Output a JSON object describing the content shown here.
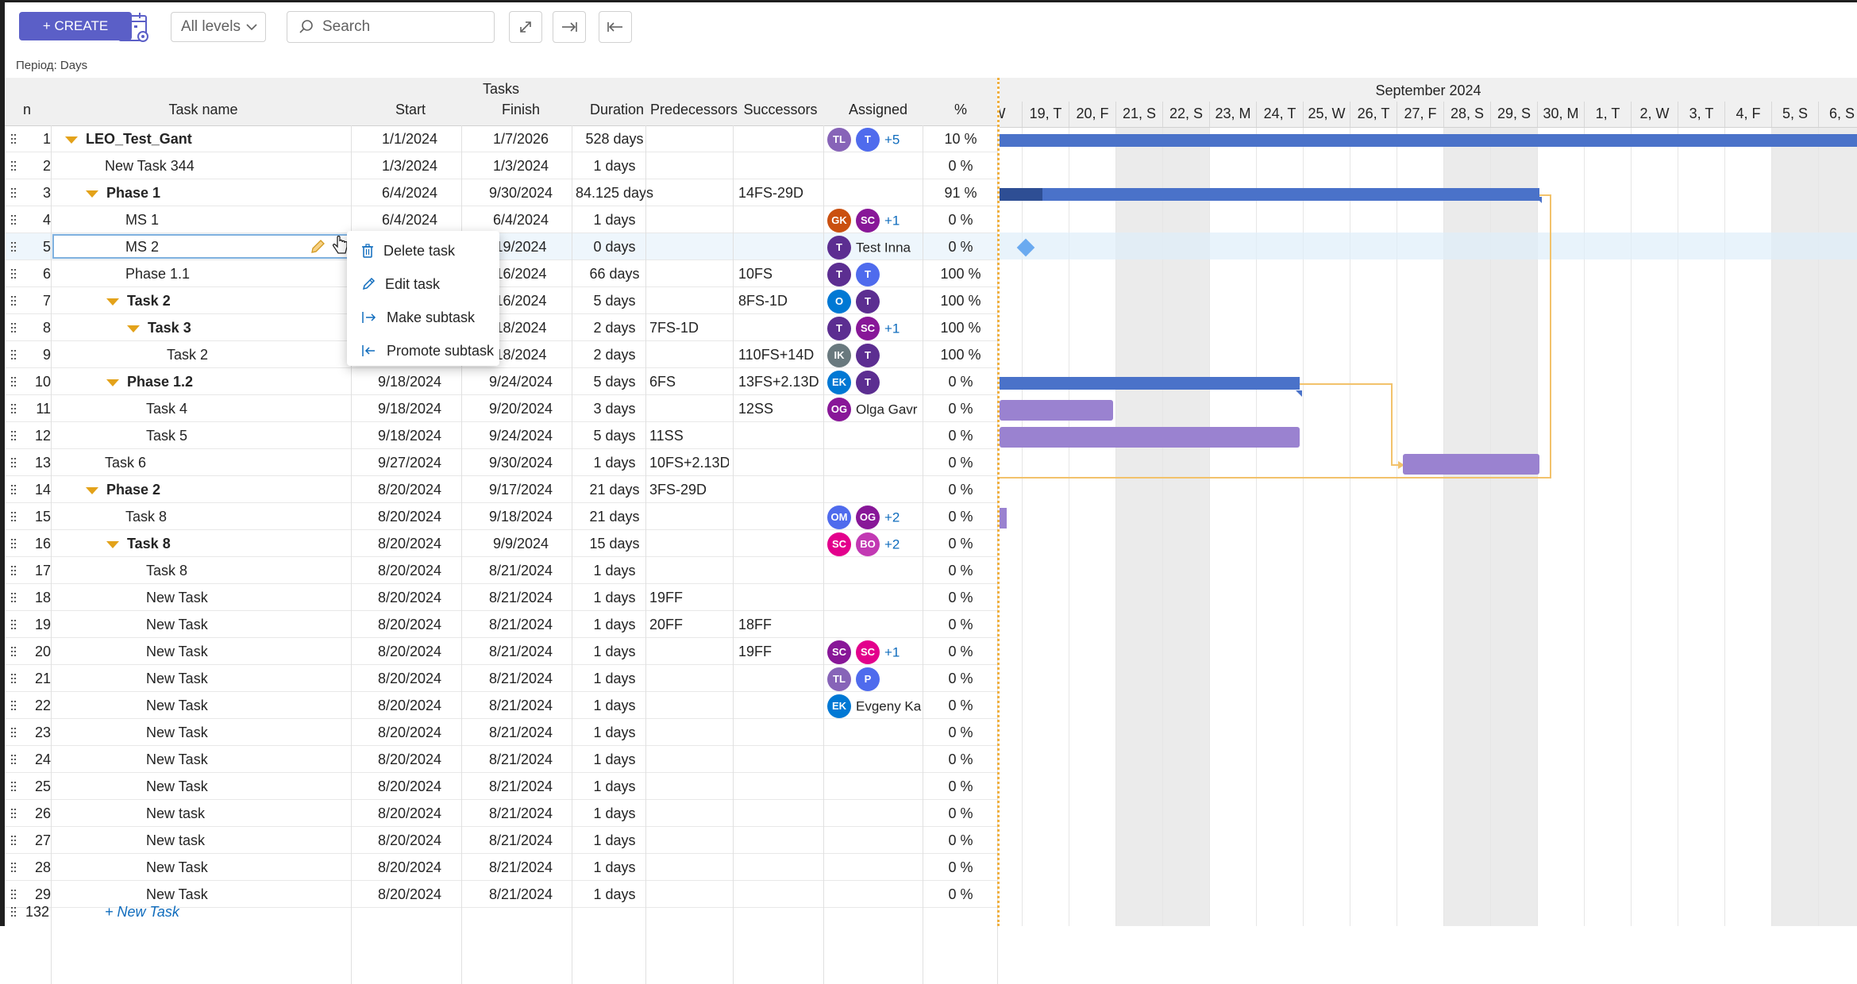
{
  "toolbar": {
    "create_label": "+ CREATE",
    "levels_label": "All levels",
    "search_placeholder": "Search",
    "period_label": "Період: Days"
  },
  "grid": {
    "group_header": "Tasks",
    "columns": [
      "n",
      "Task name",
      "Start",
      "Finish",
      "Duration",
      "Predecessors",
      "Successors",
      "Assigned",
      "%"
    ],
    "rows": [
      {
        "n": "1",
        "name": "LEO_Test_Gant",
        "start": "1/1/2024",
        "finish": "1/7/2026",
        "duration": "528 days",
        "pred": "",
        "succ": "",
        "avatars": [
          {
            "t": "TL",
            "c": "#8764b8"
          },
          {
            "t": "T",
            "c": "#4f6bed"
          }
        ],
        "more": "+5",
        "aname": "",
        "pct": "10 %"
      },
      {
        "n": "2",
        "name": "New Task 344",
        "start": "1/3/2024",
        "finish": "1/3/2024",
        "duration": "1 days",
        "pred": "",
        "succ": "",
        "avatars": [],
        "more": "",
        "aname": "",
        "pct": "0 %"
      },
      {
        "n": "3",
        "name": "Phase 1",
        "start": "6/4/2024",
        "finish": "9/30/2024",
        "duration": "84.125 days",
        "pred": "",
        "succ": "14FS-29D",
        "avatars": [],
        "more": "",
        "aname": "",
        "pct": "91 %"
      },
      {
        "n": "4",
        "name": "MS 1",
        "start": "6/4/2024",
        "finish": "6/4/2024",
        "duration": "1 days",
        "pred": "",
        "succ": "",
        "avatars": [
          {
            "t": "GK",
            "c": "#ca5010"
          },
          {
            "t": "SC",
            "c": "#881798"
          }
        ],
        "more": "+1",
        "aname": "",
        "pct": "0 %"
      },
      {
        "n": "5",
        "name": "MS 2",
        "start": "",
        "finish": "19/2024",
        "duration": "0 days",
        "pred": "",
        "succ": "",
        "avatars": [
          {
            "t": "T",
            "c": "#5c2e91"
          }
        ],
        "more": "",
        "aname": "Test Inna",
        "pct": "0 %"
      },
      {
        "n": "6",
        "name": "Phase 1.1",
        "start": "",
        "finish": "16/2024",
        "duration": "66 days",
        "pred": "",
        "succ": "10FS",
        "avatars": [
          {
            "t": "T",
            "c": "#5c2e91"
          },
          {
            "t": "T",
            "c": "#4f6bed"
          }
        ],
        "more": "",
        "aname": "",
        "pct": "100 %"
      },
      {
        "n": "7",
        "name": "Task 2",
        "start": "",
        "finish": "16/2024",
        "duration": "5 days",
        "pred": "",
        "succ": "8FS-1D",
        "avatars": [
          {
            "t": "O",
            "c": "#0078d4"
          },
          {
            "t": "T",
            "c": "#5c2e91"
          }
        ],
        "more": "",
        "aname": "",
        "pct": "100 %"
      },
      {
        "n": "8",
        "name": "Task 3",
        "start": "",
        "finish": "18/2024",
        "duration": "2 days",
        "pred": "7FS-1D",
        "succ": "",
        "avatars": [
          {
            "t": "T",
            "c": "#5c2e91"
          },
          {
            "t": "SC",
            "c": "#881798"
          }
        ],
        "more": "+1",
        "aname": "",
        "pct": "100 %"
      },
      {
        "n": "9",
        "name": "Task 2",
        "start": "",
        "finish": "18/2024",
        "duration": "2 days",
        "pred": "",
        "succ": "110FS+14D",
        "avatars": [
          {
            "t": "IK",
            "c": "#69797e"
          },
          {
            "t": "T",
            "c": "#5c2e91"
          }
        ],
        "more": "",
        "aname": "",
        "pct": "100 %"
      },
      {
        "n": "10",
        "name": "Phase 1.2",
        "start": "9/18/2024",
        "finish": "9/24/2024",
        "duration": "5 days",
        "pred": "6FS",
        "succ": "13FS+2.13D",
        "avatars": [
          {
            "t": "EK",
            "c": "#0078d4"
          },
          {
            "t": "T",
            "c": "#5c2e91"
          }
        ],
        "more": "",
        "aname": "",
        "pct": "0 %"
      },
      {
        "n": "11",
        "name": "Task 4",
        "start": "9/18/2024",
        "finish": "9/20/2024",
        "duration": "3 days",
        "pred": "",
        "succ": "12SS",
        "avatars": [
          {
            "t": "OG",
            "c": "#881798"
          }
        ],
        "more": "",
        "aname": "Olga Gavr",
        "pct": "0 %"
      },
      {
        "n": "12",
        "name": "Task 5",
        "start": "9/18/2024",
        "finish": "9/24/2024",
        "duration": "5 days",
        "pred": "11SS",
        "succ": "",
        "avatars": [],
        "more": "",
        "aname": "",
        "pct": "0 %"
      },
      {
        "n": "13",
        "name": "Task 6",
        "start": "9/27/2024",
        "finish": "9/30/2024",
        "duration": "1 days",
        "pred": "10FS+2.13D",
        "succ": "",
        "avatars": [],
        "more": "",
        "aname": "",
        "pct": "0 %"
      },
      {
        "n": "14",
        "name": "Phase 2",
        "start": "8/20/2024",
        "finish": "9/17/2024",
        "duration": "21 days",
        "pred": "3FS-29D",
        "succ": "",
        "avatars": [],
        "more": "",
        "aname": "",
        "pct": "0 %"
      },
      {
        "n": "15",
        "name": "Task 8",
        "start": "8/20/2024",
        "finish": "9/18/2024",
        "duration": "21 days",
        "pred": "",
        "succ": "",
        "avatars": [
          {
            "t": "OM",
            "c": "#4f6bed"
          },
          {
            "t": "OG",
            "c": "#881798"
          }
        ],
        "more": "+2",
        "aname": "",
        "pct": "0 %"
      },
      {
        "n": "16",
        "name": "Task 8",
        "start": "8/20/2024",
        "finish": "9/9/2024",
        "duration": "15 days",
        "pred": "",
        "succ": "",
        "avatars": [
          {
            "t": "SC",
            "c": "#e3008c"
          },
          {
            "t": "BO",
            "c": "#c239b3"
          }
        ],
        "more": "+2",
        "aname": "",
        "pct": "0 %"
      },
      {
        "n": "17",
        "name": "Task 8",
        "start": "8/20/2024",
        "finish": "8/21/2024",
        "duration": "1 days",
        "pred": "",
        "succ": "",
        "avatars": [],
        "more": "",
        "aname": "",
        "pct": "0 %"
      },
      {
        "n": "18",
        "name": "New Task",
        "start": "8/20/2024",
        "finish": "8/21/2024",
        "duration": "1 days",
        "pred": "19FF",
        "succ": "",
        "avatars": [],
        "more": "",
        "aname": "",
        "pct": "0 %"
      },
      {
        "n": "19",
        "name": "New Task",
        "start": "8/20/2024",
        "finish": "8/21/2024",
        "duration": "1 days",
        "pred": "20FF",
        "succ": "18FF",
        "avatars": [],
        "more": "",
        "aname": "",
        "pct": "0 %"
      },
      {
        "n": "20",
        "name": "New Task",
        "start": "8/20/2024",
        "finish": "8/21/2024",
        "duration": "1 days",
        "pred": "",
        "succ": "19FF",
        "avatars": [
          {
            "t": "SC",
            "c": "#881798"
          },
          {
            "t": "SC",
            "c": "#e3008c"
          }
        ],
        "more": "+1",
        "aname": "",
        "pct": "0 %"
      },
      {
        "n": "21",
        "name": "New Task",
        "start": "8/20/2024",
        "finish": "8/21/2024",
        "duration": "1 days",
        "pred": "",
        "succ": "",
        "avatars": [
          {
            "t": "TL",
            "c": "#8764b8"
          },
          {
            "t": "P",
            "c": "#4f6bed"
          }
        ],
        "more": "",
        "aname": "",
        "pct": "0 %"
      },
      {
        "n": "22",
        "name": "New Task",
        "start": "8/20/2024",
        "finish": "8/21/2024",
        "duration": "1 days",
        "pred": "",
        "succ": "",
        "avatars": [
          {
            "t": "EK",
            "c": "#0078d4"
          }
        ],
        "more": "",
        "aname": "Evgeny Ka",
        "pct": "0 %"
      },
      {
        "n": "23",
        "name": "New Task",
        "start": "8/20/2024",
        "finish": "8/21/2024",
        "duration": "1 days",
        "pred": "",
        "succ": "",
        "avatars": [],
        "more": "",
        "aname": "",
        "pct": "0 %"
      },
      {
        "n": "24",
        "name": "New Task",
        "start": "8/20/2024",
        "finish": "8/21/2024",
        "duration": "1 days",
        "pred": "",
        "succ": "",
        "avatars": [],
        "more": "",
        "aname": "",
        "pct": "0 %"
      },
      {
        "n": "25",
        "name": "New Task",
        "start": "8/20/2024",
        "finish": "8/21/2024",
        "duration": "1 days",
        "pred": "",
        "succ": "",
        "avatars": [],
        "more": "",
        "aname": "",
        "pct": "0 %"
      },
      {
        "n": "26",
        "name": "New task",
        "start": "8/20/2024",
        "finish": "8/21/2024",
        "duration": "1 days",
        "pred": "",
        "succ": "",
        "avatars": [],
        "more": "",
        "aname": "",
        "pct": "0 %"
      },
      {
        "n": "27",
        "name": "New task",
        "start": "8/20/2024",
        "finish": "8/21/2024",
        "duration": "1 days",
        "pred": "",
        "succ": "",
        "avatars": [],
        "more": "",
        "aname": "",
        "pct": "0 %"
      },
      {
        "n": "28",
        "name": "New Task",
        "start": "8/20/2024",
        "finish": "8/21/2024",
        "duration": "1 days",
        "pred": "",
        "succ": "",
        "avatars": [],
        "more": "",
        "aname": "",
        "pct": "0 %"
      },
      {
        "n": "29",
        "name": "New Task",
        "start": "8/20/2024",
        "finish": "8/21/2024",
        "duration": "1 days",
        "pred": "",
        "succ": "",
        "avatars": [],
        "more": "",
        "aname": "",
        "pct": "0 %"
      }
    ],
    "footer": {
      "count": "132",
      "new_task_label": "+ New Task"
    }
  },
  "context_menu": {
    "items": [
      "Delete task",
      "Edit task",
      "Make subtask",
      "Promote subtask"
    ]
  },
  "gantt": {
    "month_label": "September 2024",
    "days": [
      "W",
      "19, T",
      "20, F",
      "21, S",
      "22, S",
      "23, M",
      "24, T",
      "25, W",
      "26, T",
      "27, F",
      "28, S",
      "29, S",
      "30, M",
      "1, T",
      "2, W",
      "3, T",
      "4, F",
      "5, S",
      "6, S"
    ],
    "weekend_days": [
      "21, S",
      "22, S",
      "28, S",
      "29, S",
      "5, S",
      "6, S"
    ],
    "colors": {
      "summary": "#4a72c9",
      "summary_dark": "#2e4e94",
      "task": "#9a82d0",
      "milestone": "#6aaaf0",
      "link": "#f2c26b"
    }
  }
}
